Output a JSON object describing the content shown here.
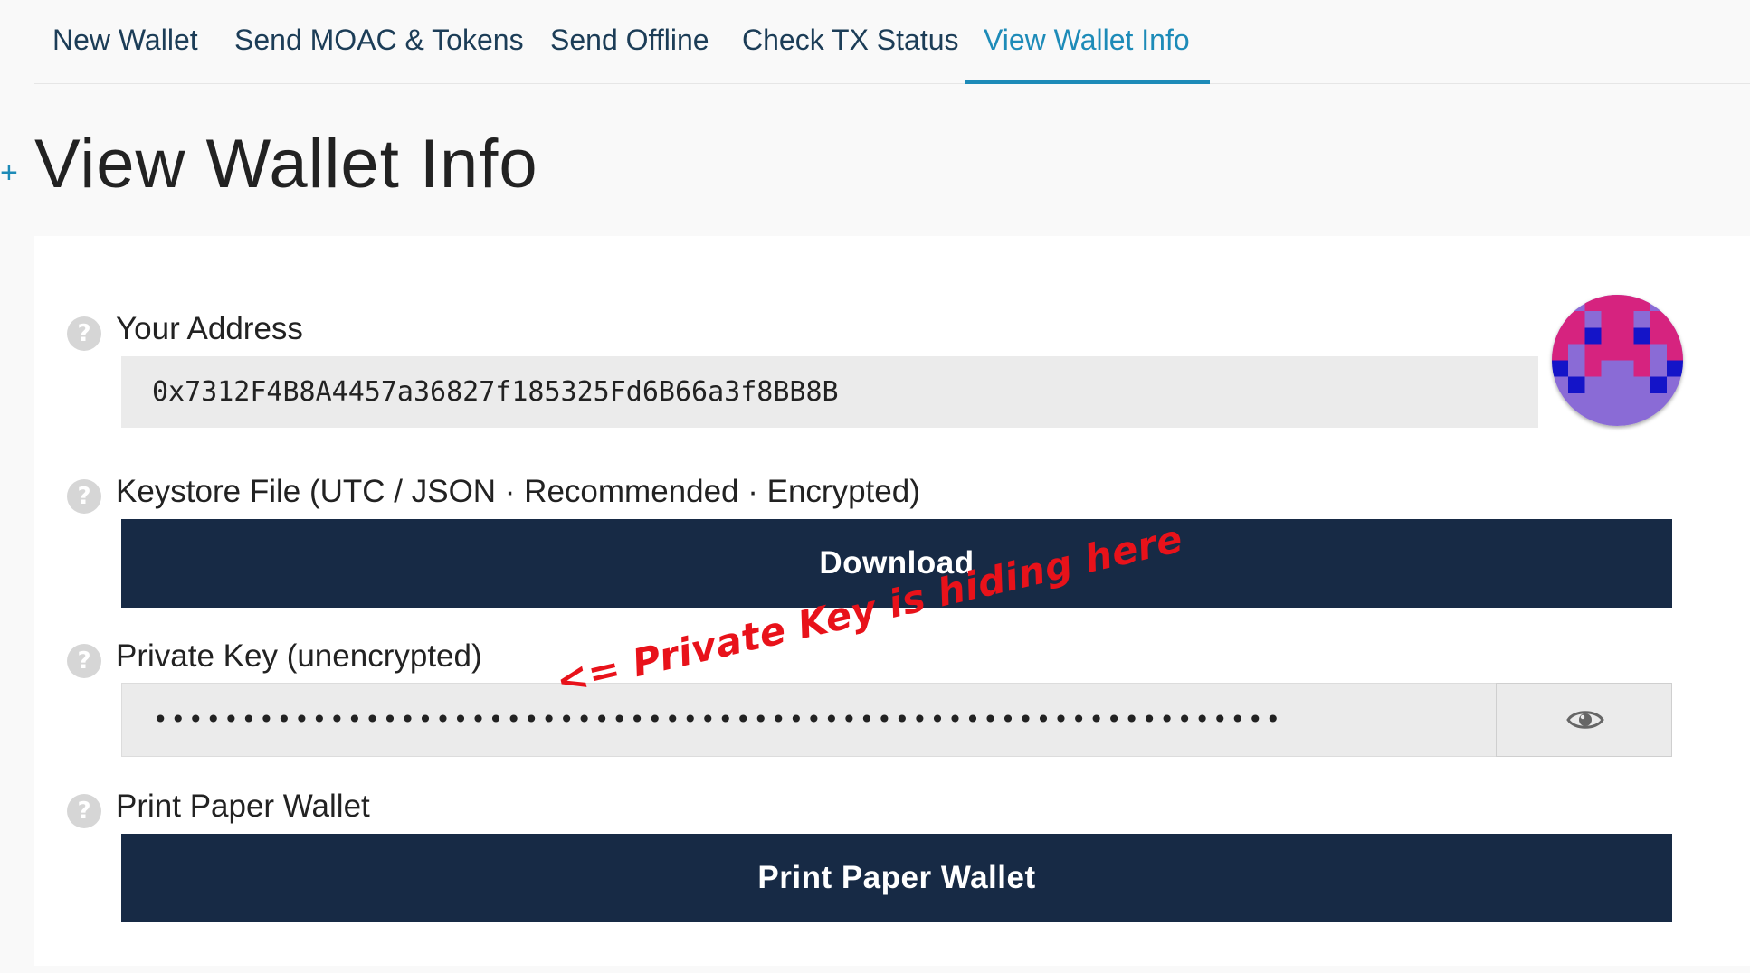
{
  "nav": {
    "tabs": [
      {
        "label": "New Wallet",
        "active": false
      },
      {
        "label": "Send MOAC & Tokens",
        "active": false
      },
      {
        "label": "Send Offline",
        "active": false
      },
      {
        "label": "Check TX Status",
        "active": false
      },
      {
        "label": "View Wallet Info",
        "active": true
      }
    ]
  },
  "page": {
    "title": "View Wallet Info",
    "expand_icon": "+"
  },
  "address": {
    "help_icon": "?",
    "label": "Your Address",
    "value": "0x7312F4B8A4457a36827f185325Fd6B66a3f8BB8B"
  },
  "keystore": {
    "help_icon": "?",
    "label": "Keystore File (UTC / JSON · Recommended · Encrypted)",
    "button_label": "Download"
  },
  "private_key": {
    "help_icon": "?",
    "label": "Private Key (unencrypted)",
    "masked_value": "••••••••••••••••••••••••••••••••••••••••••••••••••••••••••••••••",
    "toggle_icon": "eye-icon"
  },
  "paper_wallet": {
    "help_icon": "?",
    "label": "Print Paper Wallet",
    "button_label": "Print Paper Wallet"
  },
  "annotation": {
    "text": "<= Private Key is hiding here",
    "color": "#e8121a"
  },
  "colors": {
    "accent": "#1d8bb8",
    "nav_text": "#1c3d57",
    "button_bg": "#172a45",
    "identicon_primary": "#d6237f",
    "identicon_bg": "#8a6bd6",
    "identicon_spot": "#1414c8"
  }
}
